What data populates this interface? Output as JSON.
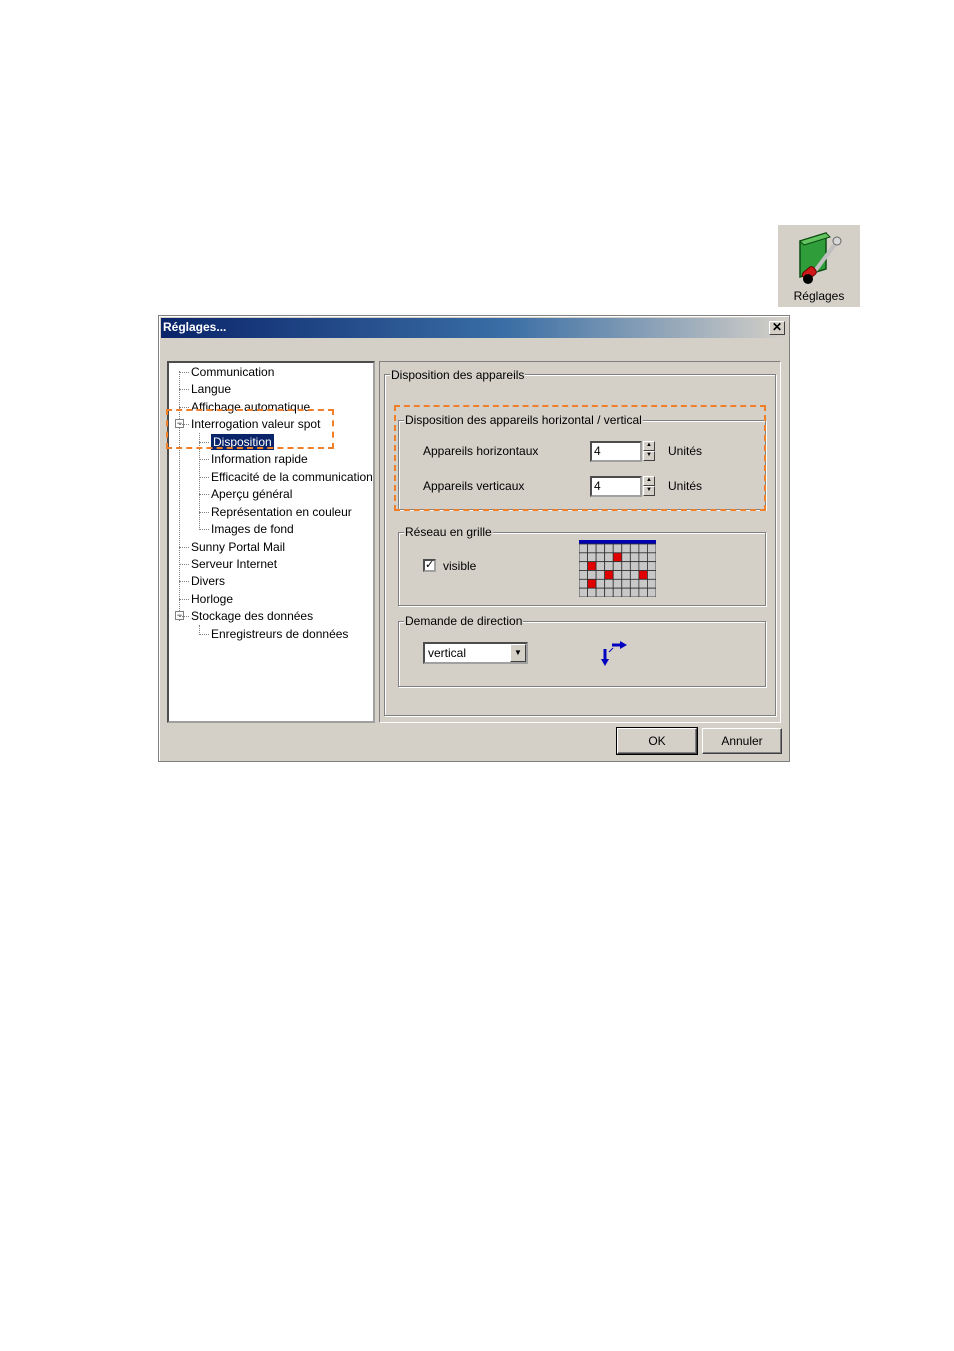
{
  "toolbar_icon": {
    "label": "Réglages",
    "icon": "settings-tools-icon"
  },
  "dialog": {
    "title": "Réglages...",
    "close_glyph": "✕",
    "tree": [
      {
        "label": "Communication",
        "level": 0
      },
      {
        "label": "Langue",
        "level": 0
      },
      {
        "label": "Affichage automatique",
        "level": 0
      },
      {
        "label": "Interrogation valeur spot",
        "level": 0,
        "expanded": true
      },
      {
        "label": "Disposition",
        "level": 1,
        "selected": true
      },
      {
        "label": "Information rapide",
        "level": 1
      },
      {
        "label": "Efficacité de la communication",
        "level": 1
      },
      {
        "label": "Aperçu général",
        "level": 1
      },
      {
        "label": "Représentation en couleur",
        "level": 1
      },
      {
        "label": "Images de fond",
        "level": 1
      },
      {
        "label": "Sunny Portal Mail",
        "level": 0
      },
      {
        "label": "Serveur Internet",
        "level": 0
      },
      {
        "label": "Divers",
        "level": 0
      },
      {
        "label": "Horloge",
        "level": 0
      },
      {
        "label": "Stockage des données",
        "level": 0,
        "expanded": true
      },
      {
        "label": "Enregistreurs de données",
        "level": 1
      }
    ],
    "panel": {
      "title": "Disposition des appareils",
      "layout_group": {
        "title": "Disposition des appareils horizontal / vertical",
        "horizontal_label": "Appareils horizontaux",
        "horizontal_value": "4",
        "vertical_label": "Appareils verticaux",
        "vertical_value": "4",
        "unit": "Unités"
      },
      "grid_group": {
        "title": "Réseau en grille",
        "checkbox_label": "visible",
        "checked": true
      },
      "direction_group": {
        "title": "Demande de direction",
        "selected": "vertical"
      }
    },
    "buttons": {
      "ok": "OK",
      "cancel": "Annuler"
    }
  },
  "colors": {
    "highlight": "#f07f2a",
    "titlebar": "#0a246a",
    "red_cell": "#e00000",
    "arrow": "#0000c0"
  }
}
